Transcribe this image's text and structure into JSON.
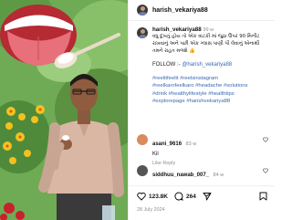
{
  "post": {
    "username": "harish_vekariya88",
    "caption_time": "99 w",
    "caption_gujarati": "વધુ દુખતું હોય તો એક વાટકી માં જુઠા ઉપર 90 મિનીટ રાખવાનું અને પછી એક ગ્લાસ પાણી પી લેવાનું એનાથી તમને રાહત મળશે 👍",
    "follow_prefix": "FOLLOW :-",
    "follow_handle": "@harish_vekariya88",
    "hashtags_1": "#reelitfeelit #reelsinstagram",
    "hashtags_2": "#reelkarofeelkaro #headache #solutions",
    "hashtags_3": "#drink #healthylifestyle #healthtips",
    "hashtags_4": "#explorepage #harishvekariya88"
  },
  "comments": [
    {
      "username": "asani_9616",
      "time": "83 w",
      "text": "Kil",
      "meta": "Like   Reply"
    },
    {
      "username": "siddhuu_nawab_007_",
      "time": "84 w",
      "text": "",
      "meta": ""
    }
  ],
  "actions": {
    "likes": "123.8K",
    "comments": "264",
    "date": "28 July 2024"
  },
  "icons": [
    "heart-icon",
    "comment-icon",
    "share-icon",
    "bookmark-icon"
  ],
  "colors": {
    "link": "#3b68b3",
    "muted": "#8e8e8e",
    "tongue": "#e8707a",
    "leaf": "#7db366"
  }
}
